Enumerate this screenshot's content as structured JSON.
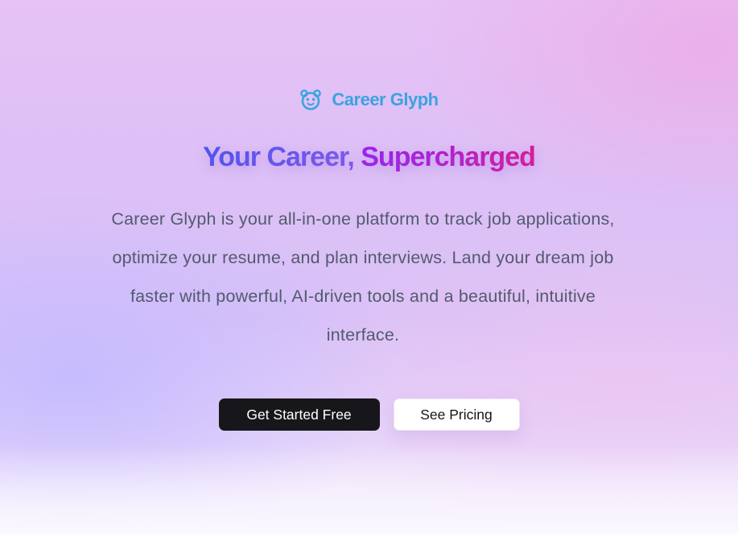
{
  "brand": {
    "name": "Career Glyph",
    "icon": "bear-face-icon",
    "color": "#3ba3e0"
  },
  "hero": {
    "headline_part1": "Your Career,",
    "headline_part2": "Supercharged",
    "description": "Career Glyph is your all-in-one platform to track job applications, optimize your resume, and plan interviews. Land your dream job faster with powerful, AI-driven tools and a beautiful, intuitive interface.",
    "gradient_colors": [
      "#4f54f3",
      "#a020e6",
      "#e0188f"
    ]
  },
  "actions": {
    "primary_label": "Get Started Free",
    "secondary_label": "See Pricing"
  }
}
